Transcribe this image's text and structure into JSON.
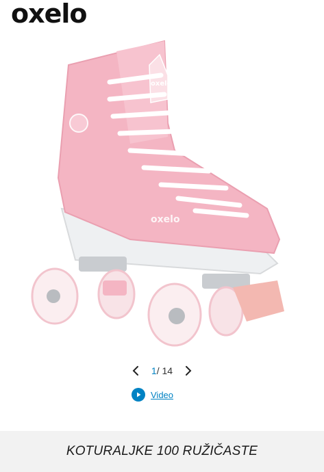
{
  "header": {
    "logo_text": "oxelo"
  },
  "gallery": {
    "current": "1",
    "separator": "/",
    "total": "14",
    "video_label": "Video",
    "image_brand_text": "oxelo"
  },
  "product": {
    "title": "KOTURALJKE 100 RUŽIČASTE"
  },
  "colors": {
    "accent": "#0082c3",
    "skate_pink": "#f4b5c3",
    "title_band": "#f2f2f2"
  }
}
